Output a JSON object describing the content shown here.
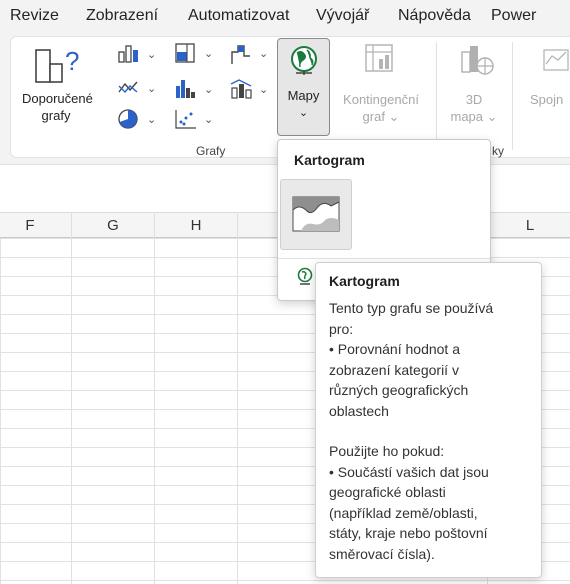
{
  "menu": {
    "tabs": [
      "Revize",
      "Zobrazení",
      "Automatizovat",
      "Vývojář",
      "Nápověda",
      "Power"
    ]
  },
  "ribbon": {
    "recommended": {
      "line1": "Doporučené",
      "line2": "grafy"
    },
    "group_label": "Grafy",
    "maps": {
      "label": "Mapy",
      "chevron": "⌄"
    },
    "pivot_chart": {
      "line1": "Kontingenční",
      "line2": "graf ⌄"
    },
    "map3d": {
      "line1": "3D",
      "line2": "mapa ⌄"
    },
    "sparkline_partial": "Spojn",
    "next_group_partial": "ky"
  },
  "sheet": {
    "columns": [
      "F",
      "G",
      "H",
      "L"
    ]
  },
  "dropdown": {
    "title": "Kartogram"
  },
  "tooltip": {
    "title": "Kartogram",
    "lines1": [
      "Tento typ grafu se používá",
      "pro:",
      "• Porovnání hodnot a",
      "zobrazení kategorií v",
      "různých geografických",
      "oblastech"
    ],
    "lines2": [
      "Použijte ho pokud:",
      "• Součástí vašich dat jsou",
      "geografické oblasti",
      "(například země/oblasti,",
      "státy, kraje nebo poštovní",
      "směrovací čísla)."
    ]
  },
  "colors": {
    "accent_green": "#1b7a3e",
    "chart_blue": "#2a62c9",
    "ribbon_bg": "#f3f3f3"
  }
}
